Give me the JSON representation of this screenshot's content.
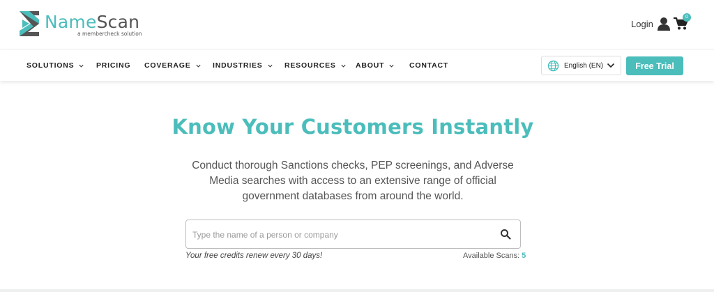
{
  "brand": {
    "name_part1": "Name",
    "name_part2": "Scan",
    "tagline": "a membercheck solution",
    "accent_color": "#4bbdbb"
  },
  "header": {
    "login_label": "Login",
    "login_icon": "user-icon",
    "cart_icon": "cart-icon",
    "cart_count": "0"
  },
  "nav": {
    "items": [
      {
        "label": "SOLUTIONS",
        "has_dropdown": true
      },
      {
        "label": "PRICING",
        "has_dropdown": false
      },
      {
        "label": "COVERAGE",
        "has_dropdown": true
      },
      {
        "label": "INDUSTRIES",
        "has_dropdown": true
      },
      {
        "label": "RESOURCES",
        "has_dropdown": true
      },
      {
        "label": "ABOUT",
        "has_dropdown": true
      },
      {
        "label": "CONTACT",
        "has_dropdown": false
      }
    ],
    "language": {
      "selected": "English (EN)",
      "icon": "globe-icon"
    },
    "cta_label": "Free Trial"
  },
  "hero": {
    "title": "Know Your Customers Instantly",
    "subtitle": "Conduct thorough Sanctions checks, PEP screenings, and Adverse Media searches with access to an extensive range of official government databases from around the world."
  },
  "search": {
    "placeholder": "Type the name of a person or company",
    "value": "",
    "icon": "search-icon",
    "credits_note": "Your free credits renew every 30 days!",
    "available_label": "Available Scans:",
    "available_count": "5"
  }
}
